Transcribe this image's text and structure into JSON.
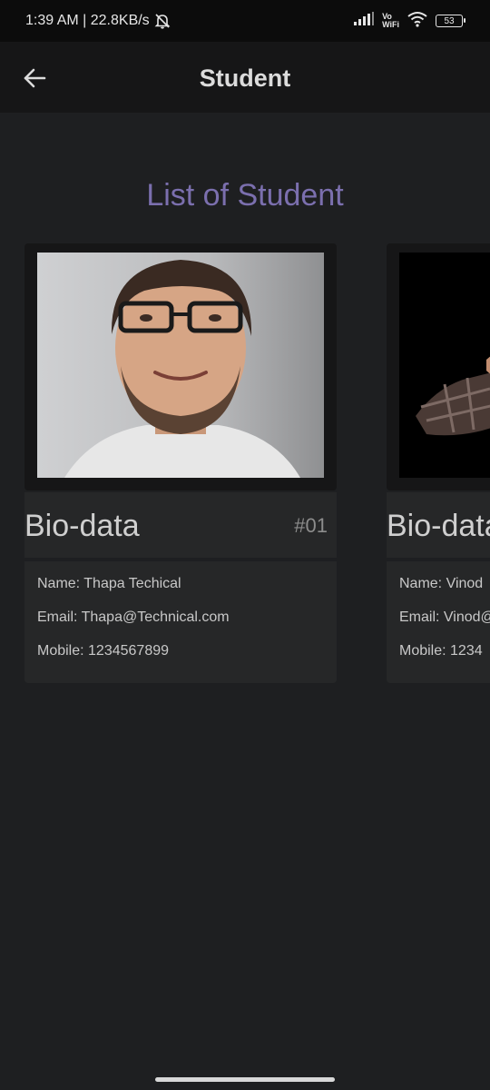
{
  "status_bar": {
    "time_speed": "1:39 AM | 22.8KB/s",
    "vowifi_top": "Vo",
    "vowifi_bottom": "WiFi",
    "battery": "53"
  },
  "app_bar": {
    "title": "Student",
    "back_icon": "arrow-left-icon"
  },
  "page": {
    "heading": "List of Student",
    "heading_color": "#7b6fae"
  },
  "students": [
    {
      "card_title": "Bio-data",
      "number": "#01",
      "name": "Name: Thapa Techical",
      "email": "Email: Thapa@Technical.com",
      "mobile": "Mobile: 1234567899"
    },
    {
      "card_title": "Bio-data",
      "name": "Name: Vinod",
      "email": "Email: Vinod@",
      "mobile": "Mobile: 1234"
    }
  ]
}
